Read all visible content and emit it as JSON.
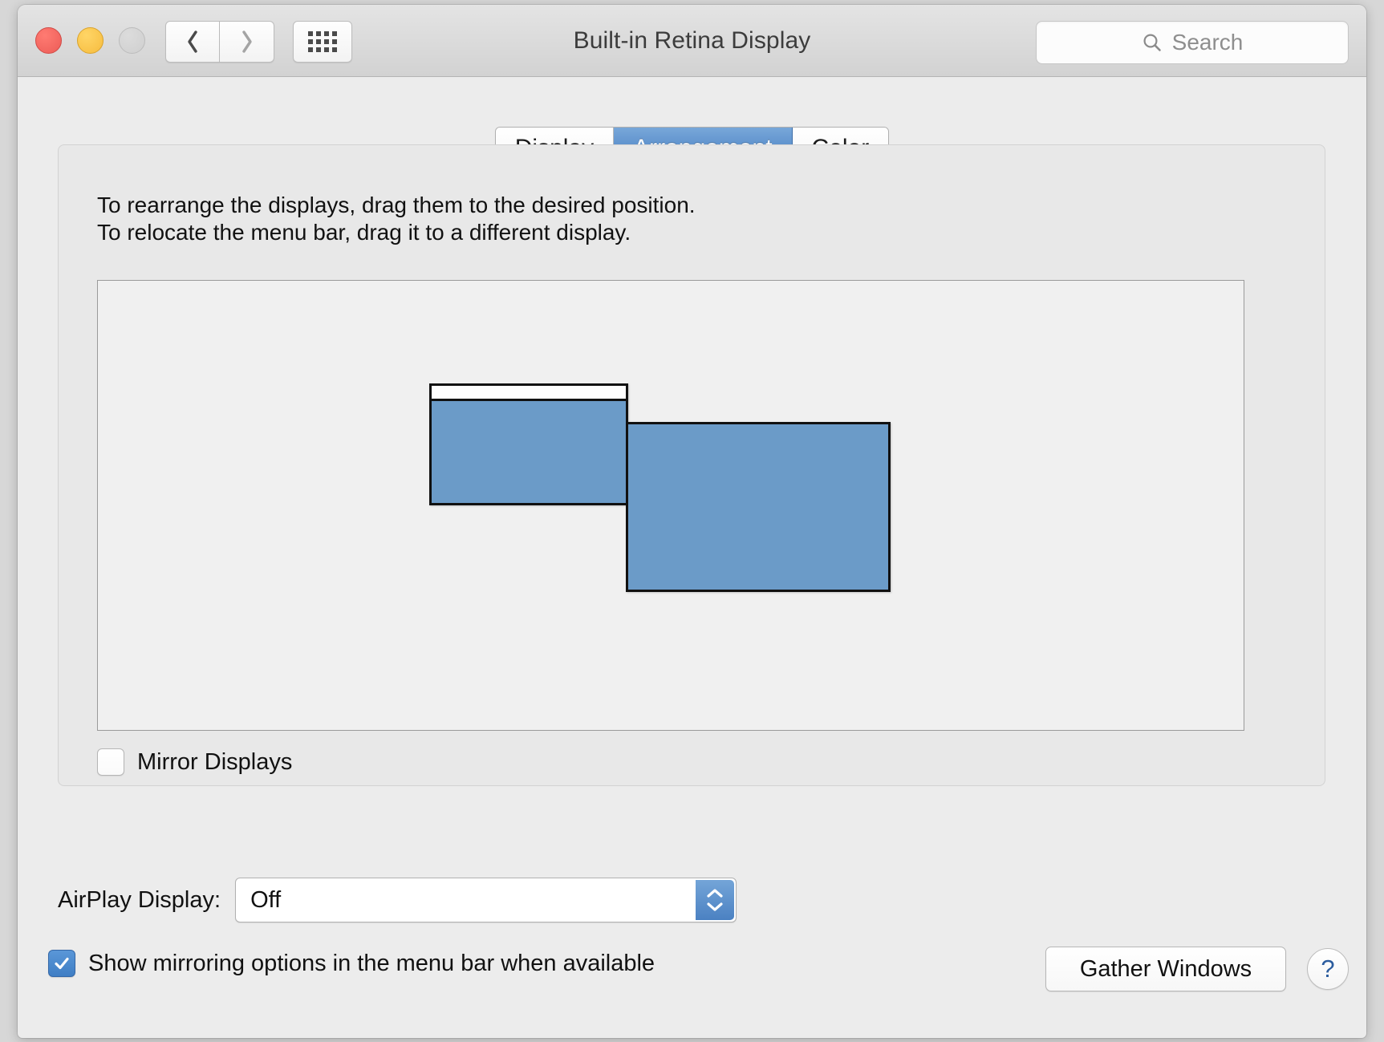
{
  "window": {
    "title": "Built-in Retina Display",
    "traffic_lights": {
      "close": "close-button",
      "minimize": "minimize-button",
      "zoom": "zoom-button"
    },
    "nav": {
      "back": "back-icon",
      "forward": "forward-icon",
      "show_all": "show-all-grid-icon"
    }
  },
  "search": {
    "icon": "search-icon",
    "placeholder": "Search",
    "value": ""
  },
  "tabs": [
    {
      "label": "Display",
      "active": false
    },
    {
      "label": "Arrangement",
      "active": true
    },
    {
      "label": "Color",
      "active": false
    }
  ],
  "instructions": {
    "line1": "To rearrange the displays, drag them to the desired position.",
    "line2": "To relocate the menu bar, drag it to a different display."
  },
  "arrangement": {
    "displays": [
      {
        "id": "display-left",
        "has_menu_bar": true
      },
      {
        "id": "display-right",
        "has_menu_bar": false
      }
    ],
    "display_color": "#6b9bc8",
    "canvas_background": "#f0f0f0"
  },
  "mirror": {
    "label": "Mirror Displays",
    "checked": false
  },
  "airplay": {
    "label": "AirPlay Display:",
    "value": "Off",
    "options": [
      "Off"
    ]
  },
  "mirroring_options": {
    "label": "Show mirroring options in the menu bar when available",
    "checked": true
  },
  "buttons": {
    "gather_windows": "Gather Windows",
    "help": "?"
  },
  "colors": {
    "accent_blue": "#4a80c0",
    "checkbox_blue": "#3f7ec4",
    "window_bg": "#ececec",
    "panel_bg": "#e8e8e8",
    "help_blue": "#2b5c9e"
  }
}
